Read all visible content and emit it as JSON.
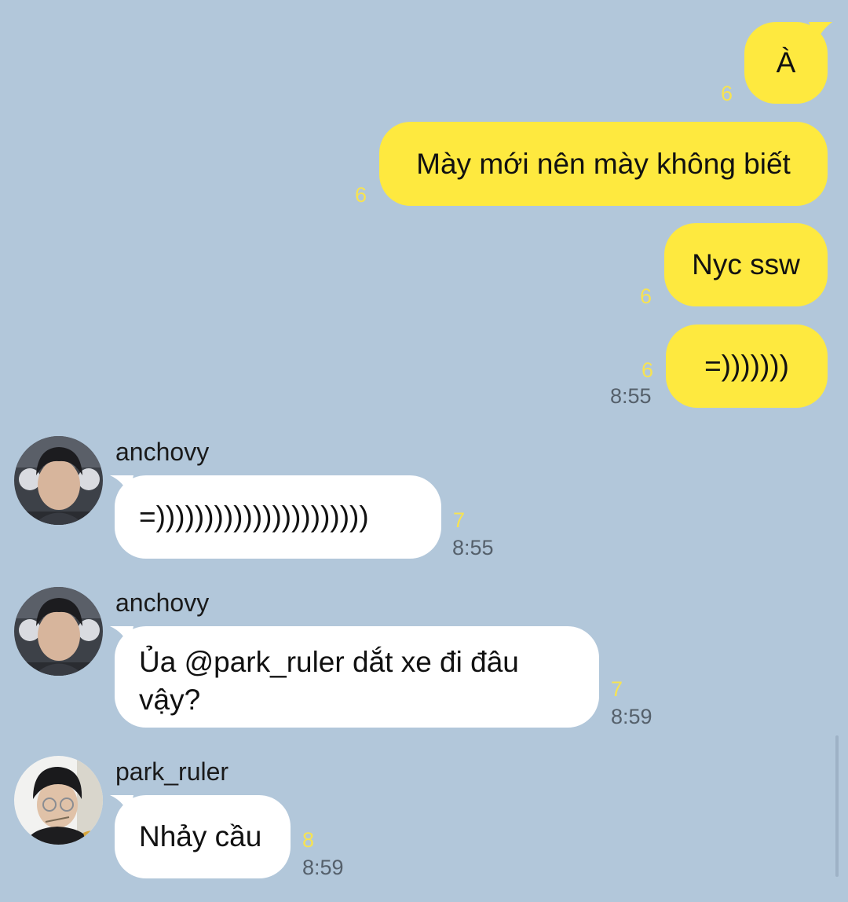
{
  "colors": {
    "background": "#b2c7da",
    "outgoing_bubble": "#fee93f",
    "incoming_bubble": "#ffffff",
    "unread_count": "#f7e351",
    "timestamp": "#55606b"
  },
  "outgoing": [
    {
      "text": "À",
      "unread": "6",
      "time": ""
    },
    {
      "text": "Mày mới nên mày không biết",
      "unread": "6",
      "time": ""
    },
    {
      "text": "Nyc ssw",
      "unread": "6",
      "time": ""
    },
    {
      "text": "=)))))))",
      "unread": "6",
      "time": "8:55"
    }
  ],
  "incoming": [
    {
      "sender": "anchovy",
      "avatar_icon": "user-photo-anchovy",
      "text": "=))))))))))))))))))))))",
      "unread": "7",
      "time": "8:55"
    },
    {
      "sender": "anchovy",
      "avatar_icon": "user-photo-anchovy",
      "text": "Ủa @park_ruler dắt xe đi đâu vậy?",
      "unread": "7",
      "time": "8:59"
    },
    {
      "sender": "park_ruler",
      "avatar_icon": "user-photo-park-ruler",
      "text": "Nhảy cầu",
      "unread": "8",
      "time": "8:59"
    }
  ]
}
